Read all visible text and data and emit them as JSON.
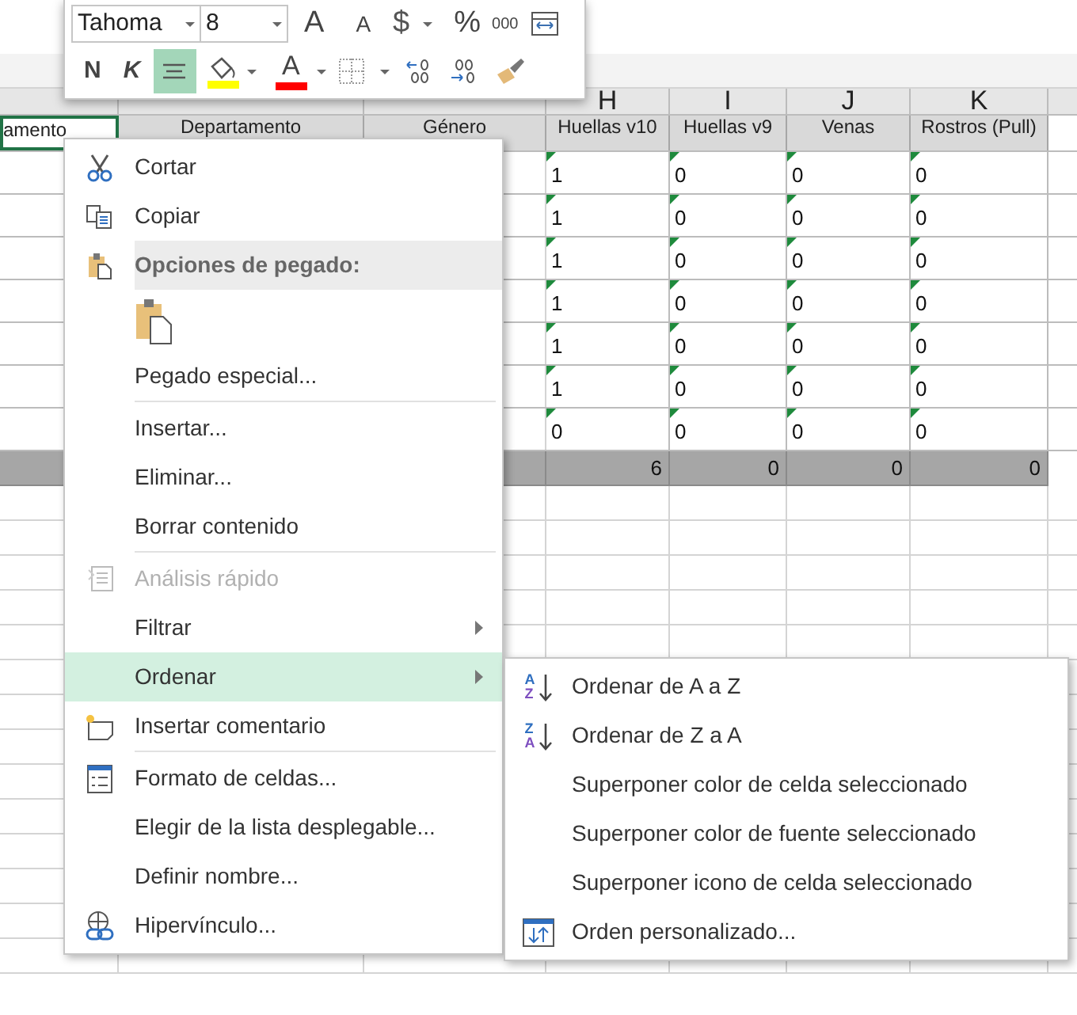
{
  "toolbar": {
    "font": "Tahoma",
    "size": "8",
    "grow_font": "A",
    "shrink_font": "A",
    "currency": "$",
    "percent": "%",
    "thousands": "000",
    "bold": "N",
    "italic": "K",
    "align_center": {
      "selected": true
    },
    "font_color": "A"
  },
  "sheet": {
    "columns": [
      {
        "header": "amento",
        "selected": true
      },
      {
        "header": "Departamento",
        "selected": false
      },
      {
        "header": "Género",
        "selected": false
      },
      {
        "letter": "H",
        "header": "Huellas v10",
        "selected": false
      },
      {
        "letter": "I",
        "header": "Huellas v9",
        "selected": false
      },
      {
        "letter": "J",
        "header": "Venas",
        "selected": false
      },
      {
        "letter": "K",
        "header": "Rostros (Pull)",
        "selected": false
      }
    ],
    "rows": [
      {
        "cells": [
          "1",
          "0",
          "0",
          "0"
        ],
        "error_marks": true
      },
      {
        "cells": [
          "1",
          "0",
          "0",
          "0"
        ],
        "error_marks": true
      },
      {
        "cells": [
          "1",
          "0",
          "0",
          "0"
        ],
        "error_marks": true
      },
      {
        "cells": [
          "1",
          "0",
          "0",
          "0"
        ],
        "error_marks": true
      },
      {
        "cells": [
          "1",
          "0",
          "0",
          "0"
        ],
        "error_marks": true
      },
      {
        "cells": [
          "1",
          "0",
          "0",
          "0"
        ],
        "error_marks": true
      },
      {
        "cells": [
          "0",
          "0",
          "0",
          "0"
        ],
        "error_marks": true
      }
    ],
    "totals": [
      "6",
      "0",
      "0",
      "0"
    ]
  },
  "context_menu": {
    "items": [
      {
        "kind": "item",
        "label": "Cortar",
        "disabled": false,
        "submenu": false,
        "selected": false
      },
      {
        "kind": "item",
        "label": "Copiar",
        "disabled": false,
        "submenu": false,
        "selected": false
      },
      {
        "kind": "header",
        "label": "Opciones de pegado:"
      },
      {
        "kind": "paste_options"
      },
      {
        "kind": "item",
        "label": "Pegado especial...",
        "disabled": false,
        "submenu": false,
        "selected": false
      },
      {
        "kind": "separator"
      },
      {
        "kind": "item",
        "label": "Insertar...",
        "disabled": false,
        "submenu": false,
        "selected": false
      },
      {
        "kind": "item",
        "label": "Eliminar...",
        "disabled": false,
        "submenu": false,
        "selected": false
      },
      {
        "kind": "item",
        "label": "Borrar contenido",
        "disabled": false,
        "submenu": false,
        "selected": false
      },
      {
        "kind": "separator"
      },
      {
        "kind": "item",
        "label": "Análisis rápido",
        "disabled": true,
        "submenu": false,
        "selected": false
      },
      {
        "kind": "item",
        "label": "Filtrar",
        "disabled": false,
        "submenu": true,
        "selected": false
      },
      {
        "kind": "item",
        "label": "Ordenar",
        "disabled": false,
        "submenu": true,
        "selected": true
      },
      {
        "kind": "item",
        "label": "Insertar comentario",
        "disabled": false,
        "submenu": false,
        "selected": false
      },
      {
        "kind": "separator"
      },
      {
        "kind": "item",
        "label": "Formato de celdas...",
        "disabled": false,
        "submenu": false,
        "selected": false
      },
      {
        "kind": "item",
        "label": "Elegir de la lista desplegable...",
        "disabled": false,
        "submenu": false,
        "selected": false
      },
      {
        "kind": "item",
        "label": "Definir nombre...",
        "disabled": false,
        "submenu": false,
        "selected": false
      },
      {
        "kind": "item",
        "label": "Hipervínculo...",
        "disabled": false,
        "submenu": false,
        "selected": false
      }
    ]
  },
  "submenu": {
    "items": [
      {
        "label": "Ordenar de A a Z",
        "icon_letters": [
          "A",
          "Z"
        ]
      },
      {
        "label": "Ordenar de Z a A",
        "icon_letters": [
          "Z",
          "A"
        ]
      },
      {
        "label": "Superponer color de celda seleccionado"
      },
      {
        "label": "Superponer color de fuente seleccionado"
      },
      {
        "label": "Superponer icono de celda seleccionado"
      },
      {
        "label": "Orden personalizado..."
      }
    ]
  }
}
